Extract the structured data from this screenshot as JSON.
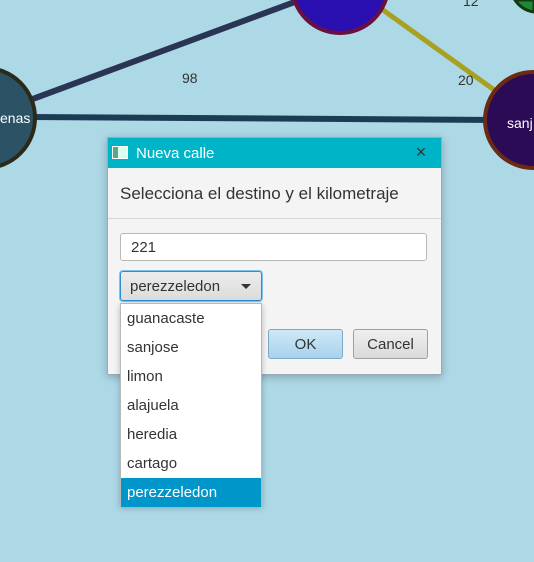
{
  "graph": {
    "edge_labels": [
      {
        "text": "12"
      },
      {
        "text": "98"
      },
      {
        "text": "20"
      }
    ],
    "node_labels": [
      {
        "text": "enas"
      },
      {
        "text": "sanj"
      }
    ]
  },
  "dialog": {
    "title": "Nueva calle",
    "header": "Selecciona el destino y el kilometraje",
    "distance_value": "221",
    "selected_destination": "perezzeledon",
    "ok_label": "OK",
    "cancel_label": "Cancel",
    "close_icon": "×"
  },
  "dropdown": {
    "options": [
      "guanacaste",
      "sanjose",
      "limon",
      "alajuela",
      "heredia",
      "cartago",
      "perezzeledon"
    ],
    "selected_index": 6
  },
  "colors": {
    "background": "#add8e6",
    "titlebar": "#00b4c8",
    "selection": "#0096c9"
  }
}
